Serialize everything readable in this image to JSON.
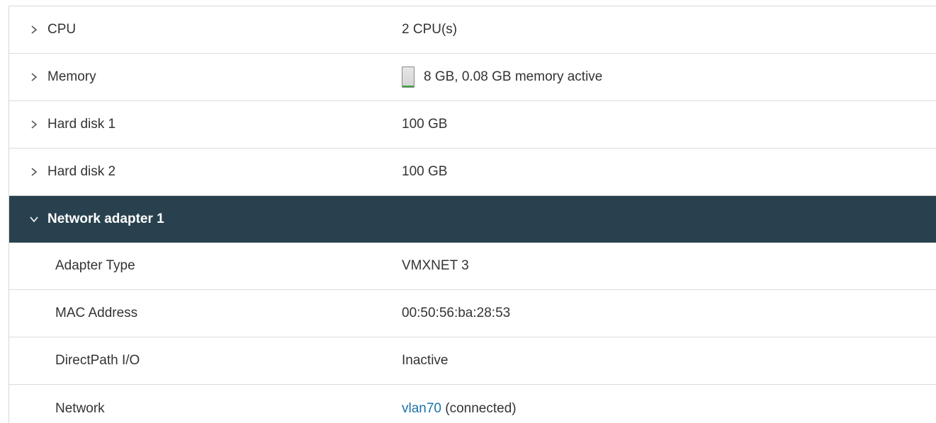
{
  "hardware": {
    "cpu": {
      "label": "CPU",
      "value": "2 CPU(s)"
    },
    "memory": {
      "label": "Memory",
      "value": "8 GB, 0.08 GB memory active",
      "usage_fraction": 0.01,
      "usage_color": "#3aa63a"
    },
    "disk1": {
      "label": "Hard disk 1",
      "value": "100 GB"
    },
    "disk2": {
      "label": "Hard disk 2",
      "value": "100 GB"
    },
    "network_adapter": {
      "label": "Network adapter 1",
      "expanded": true,
      "adapter_type": {
        "label": "Adapter Type",
        "value": "VMXNET 3"
      },
      "mac": {
        "label": "MAC Address",
        "value": "00:50:56:ba:28:53"
      },
      "directpath": {
        "label": "DirectPath I/O",
        "value": "Inactive"
      },
      "network": {
        "label": "Network",
        "link": "vlan70",
        "status": " (connected)"
      }
    }
  },
  "colors": {
    "expanded_header_bg": "#29414e",
    "link": "#1a73a8"
  },
  "icons": {
    "collapsed": "chevron-right-icon",
    "expanded": "chevron-down-icon",
    "memory": "memory-usage-icon"
  }
}
